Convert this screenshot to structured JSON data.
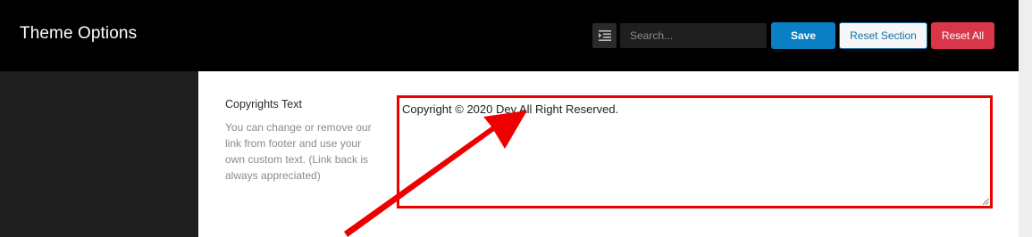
{
  "header": {
    "title": "Theme Options",
    "toggle_icon": "expand-list-icon",
    "search": {
      "placeholder": "Search...",
      "value": ""
    },
    "buttons": {
      "save_label": "Save",
      "reset_section_label": "Reset Section",
      "reset_all_label": "Reset All"
    }
  },
  "field": {
    "title": "Copyrights Text",
    "description": "You can change or remove our link from footer and use your own custom text. (Link back is always appreciated)",
    "value": "Copyright © 2020 Dev All Right Reserved."
  },
  "colors": {
    "header_bg": "#000000",
    "sidebar_bg": "#1e1e1e",
    "save_btn": "#0a7fc4",
    "reset_all_btn": "#d9364a",
    "annotation_red": "#ee0000"
  },
  "annotation": {
    "type": "arrow",
    "color": "#ee0000"
  }
}
